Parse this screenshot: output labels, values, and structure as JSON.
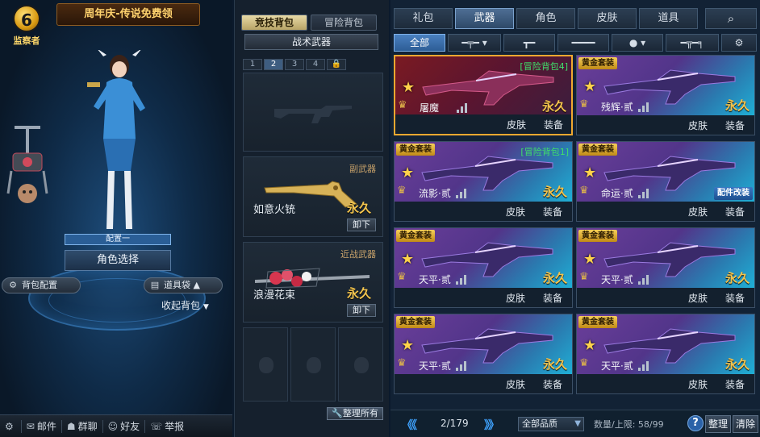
{
  "left": {
    "logo_text": "监察者",
    "promo_banner": "周年庆-传说免费领",
    "config_strip": "配置一",
    "role_select": "角色选择",
    "bag_config": "背包配置",
    "tool_bag": "道具袋",
    "collapse_bag": "收起背包",
    "bottom_bar": {
      "mail": "邮件",
      "group_chat": "群聊",
      "friends": "好友",
      "report": "举报"
    }
  },
  "loadout": {
    "tabs": [
      "竞技背包",
      "冒险背包"
    ],
    "active_tab": 0,
    "tactical_title": "战术武器",
    "slot_numbers": [
      "1",
      "2",
      "3",
      "4"
    ],
    "active_slot": 1,
    "secondary": {
      "category": "副武器",
      "name": "如意火铳",
      "duration": "永久",
      "unequip": "卸下"
    },
    "melee": {
      "category": "近战武器",
      "name": "浪漫花束",
      "duration": "永久",
      "unequip": "卸下"
    },
    "arrange_all": "整理所有"
  },
  "inventory": {
    "categories": [
      "礼包",
      "武器",
      "角色",
      "皮肤",
      "道具"
    ],
    "active_category": 1,
    "filters": [
      "全部"
    ],
    "items": [
      {
        "badge": "",
        "tag": "[冒险背包4]",
        "name": "屠魔",
        "duration": "永久",
        "skin": "皮肤",
        "equip": "装备",
        "mod": ""
      },
      {
        "badge": "黄金套装",
        "tag": "",
        "name": "残辉·贰",
        "duration": "永久",
        "skin": "皮肤",
        "equip": "装备",
        "mod": ""
      },
      {
        "badge": "黄金套装",
        "tag": "[冒险背包1]",
        "name": "流影·贰",
        "duration": "永久",
        "skin": "皮肤",
        "equip": "装备",
        "mod": ""
      },
      {
        "badge": "黄金套装",
        "tag": "",
        "name": "命运·贰",
        "duration": "",
        "skin": "皮肤",
        "equip": "装备",
        "mod": "配件改装"
      },
      {
        "badge": "黄金套装",
        "tag": "",
        "name": "天平·贰",
        "duration": "永久",
        "skin": "皮肤",
        "equip": "装备",
        "mod": ""
      },
      {
        "badge": "黄金套装",
        "tag": "",
        "name": "天平·贰",
        "duration": "永久",
        "skin": "皮肤",
        "equip": "装备",
        "mod": ""
      },
      {
        "badge": "黄金套装",
        "tag": "",
        "name": "天平·贰",
        "duration": "永久",
        "skin": "皮肤",
        "equip": "装备",
        "mod": ""
      },
      {
        "badge": "黄金套装",
        "tag": "",
        "name": "天平·贰",
        "duration": "永久",
        "skin": "皮肤",
        "equip": "装备",
        "mod": ""
      }
    ],
    "footer": {
      "page": "2/179",
      "quality": "全部品质",
      "count_label": "数量/上限: 58/99",
      "help": "?",
      "sort": "整理",
      "clear": "清除"
    }
  },
  "colors": {
    "accent_gold": "#f3c34c",
    "tag_green": "#3fe06a",
    "selected_border": "#f0a830",
    "nav_blue": "#3fa3ff"
  }
}
